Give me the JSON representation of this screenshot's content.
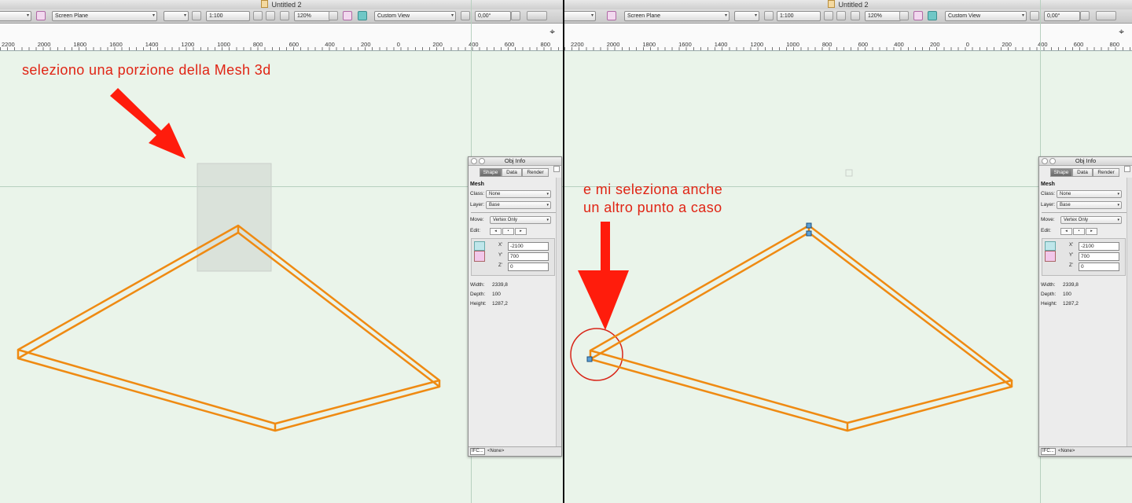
{
  "window_title": "Untitled 2",
  "toolbar": {
    "plane": "Screen Plane",
    "scale": "1:100",
    "zoom": "120%",
    "view": "Custom View",
    "angle": "0,00°"
  },
  "ruler_left": [
    "2200",
    "2000",
    "1800",
    "1600",
    "1400",
    "1200",
    "1000",
    "800",
    "600",
    "400",
    "200",
    "0",
    "200",
    "400",
    "600",
    "800"
  ],
  "ruler_right": [
    "2200",
    "2000",
    "1800",
    "1600",
    "1400",
    "1200",
    "1000",
    "800",
    "600",
    "400",
    "200",
    "0",
    "200",
    "400",
    "600",
    "800"
  ],
  "annotations": {
    "left": "seleziono una porzione della Mesh 3d",
    "right_line1": "e mi seleziona anche",
    "right_line2": "un altro punto a caso"
  },
  "objinfo": {
    "title": "Obj Info",
    "tabs": [
      "Shape",
      "Data",
      "Render"
    ],
    "section": "Mesh",
    "class_label": "Class:",
    "class_value": "None",
    "layer_label": "Layer:",
    "layer_value": "Base",
    "move_label": "Move:",
    "move_value": "Vertex Only",
    "edit_label": "Edit:",
    "x_label": "X'",
    "x_value": "-2100",
    "y_label": "Y'",
    "y_value": "700",
    "z_label": "Z'",
    "z_value": "0",
    "width_label": "Width:",
    "width_value": "2339,8",
    "depth_label": "Depth:",
    "depth_value": "100",
    "height_label": "Height:",
    "height_value": "1287,2",
    "ifc_label": "IFC...",
    "none_label": "<None>"
  },
  "colors": {
    "mesh_stroke": "#ef8a12",
    "annotation": "#e02414",
    "canvas_bg": "#eaf4ea",
    "handle": "#3e84c4"
  }
}
